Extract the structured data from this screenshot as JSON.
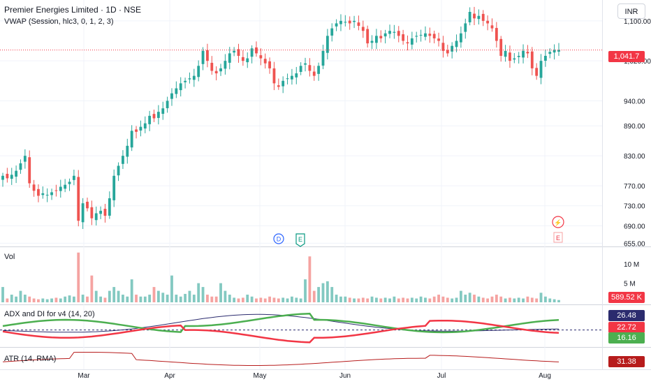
{
  "header": {
    "symbol_title": "Premier Energies Limited · 1D · NSE",
    "vwap_label": "VWAP (Session, hlc3, 0, 1, 2, 3)",
    "currency_button": "INR"
  },
  "colors": {
    "up": "#26a69a",
    "down": "#ef5350",
    "adx_line": "#2b2b6e",
    "di_plus": "#4caf50",
    "di_minus": "#f23645",
    "atr_line": "#b71c1c",
    "last_price": "#f23645",
    "grid": "#f0f3fa"
  },
  "price_axis": {
    "ticks": [
      "1,100.00",
      "1,020.00",
      "940.00",
      "890.00",
      "830.00",
      "770.00",
      "730.00",
      "690.00",
      "655.00"
    ],
    "last_price_label": "1,041.7"
  },
  "time_axis": {
    "labels": [
      "Mar",
      "Apr",
      "May",
      "Jun",
      "Jul",
      "Aug"
    ]
  },
  "markers": {
    "dividend": "D",
    "earnings": "E",
    "upcoming_earnings": "E"
  },
  "volume_pane": {
    "label": "Vol",
    "ticks": [
      "10 M",
      "5 M"
    ],
    "last_value": "589.52 K"
  },
  "adx_pane": {
    "label": "ADX and DI for v4 (14, 20)",
    "values": [
      "26.48",
      "22.72",
      "16.16"
    ]
  },
  "atr_pane": {
    "label": "ATR (14, RMA)",
    "value": "31.38"
  },
  "chart_data": {
    "type": "candlestick",
    "price_range": [
      650,
      1125
    ],
    "last_price": 1041.7,
    "closes": [
      790,
      785,
      792,
      800,
      815,
      830,
      775,
      760,
      750,
      755,
      752,
      757,
      760,
      768,
      772,
      778,
      790,
      700,
      735,
      725,
      705,
      715,
      720,
      710,
      745,
      790,
      810,
      830,
      850,
      880,
      878,
      888,
      895,
      910,
      905,
      918,
      925,
      940,
      955,
      965,
      975,
      980,
      985,
      990,
      1010,
      1040,
      1020,
      1000,
      995,
      1005,
      1020,
      1035,
      1040,
      1030,
      1020,
      1025,
      1045,
      1035,
      1025,
      1015,
      1005,
      975,
      968,
      980,
      985,
      990,
      995,
      1010,
      1015,
      1000,
      990,
      1010,
      1040,
      1070,
      1085,
      1095,
      1100,
      1098,
      1095,
      1100,
      1090,
      1080,
      1055,
      1060,
      1070,
      1065,
      1075,
      1080,
      1078,
      1070,
      1060,
      1055,
      1065,
      1070,
      1072,
      1075,
      1070,
      1065,
      1060,
      1040,
      1035,
      1050,
      1060,
      1075,
      1095,
      1118,
      1105,
      1110,
      1100,
      1095,
      1085,
      1060,
      1030,
      1040,
      1020,
      1025,
      1030,
      1040,
      1035,
      1005,
      990,
      1020,
      1030,
      1038,
      1042,
      1041.7
    ],
    "volume_millions": [
      4,
      1,
      2,
      1.5,
      3,
      2,
      1.5,
      1,
      0.8,
      1,
      0.8,
      1,
      1.2,
      1,
      1.5,
      1.8,
      1.5,
      13,
      2,
      1.5,
      7,
      3,
      1.5,
      1.2,
      3,
      4,
      3,
      2,
      1.5,
      6,
      2,
      1.5,
      1.5,
      2,
      4,
      3,
      2.5,
      2,
      7,
      2,
      1.5,
      2.2,
      3,
      2,
      5,
      4,
      2,
      1.5,
      1.5,
      5,
      3,
      2,
      1.2,
      1,
      1.2,
      2,
      1.5,
      1,
      1.2,
      1,
      1.5,
      1.2,
      1,
      1.2,
      1,
      1.5,
      1.2,
      1,
      6,
      12,
      3,
      4,
      5,
      5.5,
      4,
      2,
      1.5,
      1.5,
      1.2,
      1,
      1,
      1.2,
      1,
      1.5,
      1.2,
      1,
      1.2,
      1,
      1.5,
      1,
      1.2,
      1,
      1.2,
      1,
      1.5,
      1.2,
      1,
      1.5,
      2,
      1.5,
      1.2,
      1,
      1.2,
      3,
      2,
      2.5,
      2,
      1.5,
      1.2,
      1,
      1.5,
      2,
      1.5,
      1,
      1.2,
      1,
      1.2,
      1,
      1.5,
      1.2,
      1,
      2.5,
      1.5,
      1,
      0.8,
      0.6
    ]
  }
}
